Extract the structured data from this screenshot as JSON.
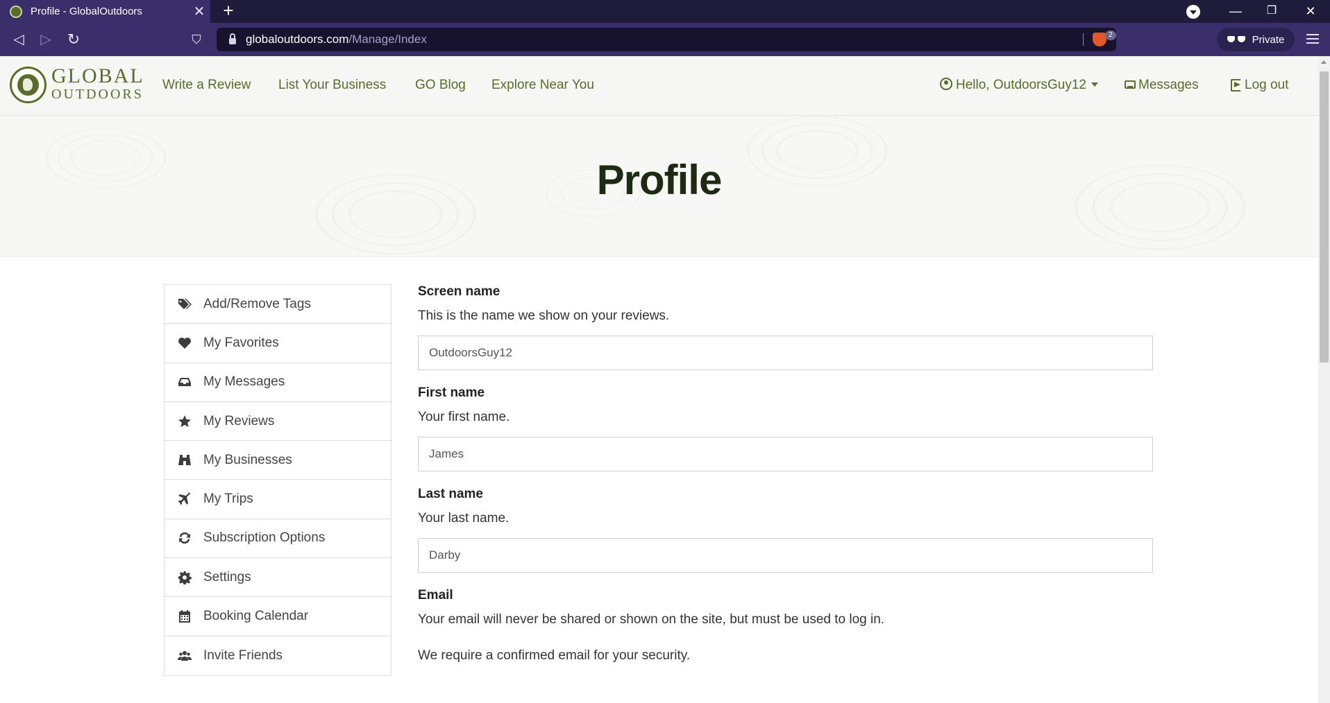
{
  "browser": {
    "tab_title": "Profile - GlobalOutdoors",
    "tab_close": "✕",
    "new_tab": "+",
    "url_host": "globaloutdoors.com",
    "url_path": "/Manage/Index",
    "shield_count": "2",
    "private_label": "Private",
    "minimize": "—",
    "restore": "❐",
    "close": "✕",
    "back": "◁",
    "forward": "▷",
    "reload": "↻",
    "bookmark": "⛉"
  },
  "header": {
    "logo_line1": "GLOBAL",
    "logo_line2": "OUTDOORS",
    "nav": [
      "Write a Review",
      "List Your Business",
      "GO Blog",
      "Explore Near You"
    ],
    "user_greeting": "Hello, OutdoorsGuy12",
    "messages": "Messages",
    "logout": "Log out"
  },
  "hero": {
    "title": "Profile"
  },
  "sidebar": {
    "items": [
      {
        "label": "Add/Remove Tags",
        "icon": "tags-icon"
      },
      {
        "label": "My Favorites",
        "icon": "heart-icon"
      },
      {
        "label": "My Messages",
        "icon": "inbox-icon"
      },
      {
        "label": "My Reviews",
        "icon": "star-icon"
      },
      {
        "label": "My Businesses",
        "icon": "binoculars-icon"
      },
      {
        "label": "My Trips",
        "icon": "plane-icon"
      },
      {
        "label": "Subscription Options",
        "icon": "refresh-icon"
      },
      {
        "label": "Settings",
        "icon": "gear-icon"
      },
      {
        "label": "Booking Calendar",
        "icon": "calendar-icon"
      },
      {
        "label": "Invite Friends",
        "icon": "users-icon"
      }
    ]
  },
  "form": {
    "screen_name": {
      "label": "Screen name",
      "help": "This is the name we show on your reviews.",
      "value": "OutdoorsGuy12"
    },
    "first_name": {
      "label": "First name",
      "help": "Your first name.",
      "value": "James"
    },
    "last_name": {
      "label": "Last name",
      "help": "Your last name.",
      "value": "Darby"
    },
    "email": {
      "label": "Email",
      "help": "Your email will never be shared or shown on the site, but must be used to log in.",
      "help2": "We require a confirmed email for your security."
    }
  },
  "colors": {
    "brand": "#5b6b2a",
    "browser_chrome": "#3a2f6b",
    "title": "#1e2a12"
  }
}
